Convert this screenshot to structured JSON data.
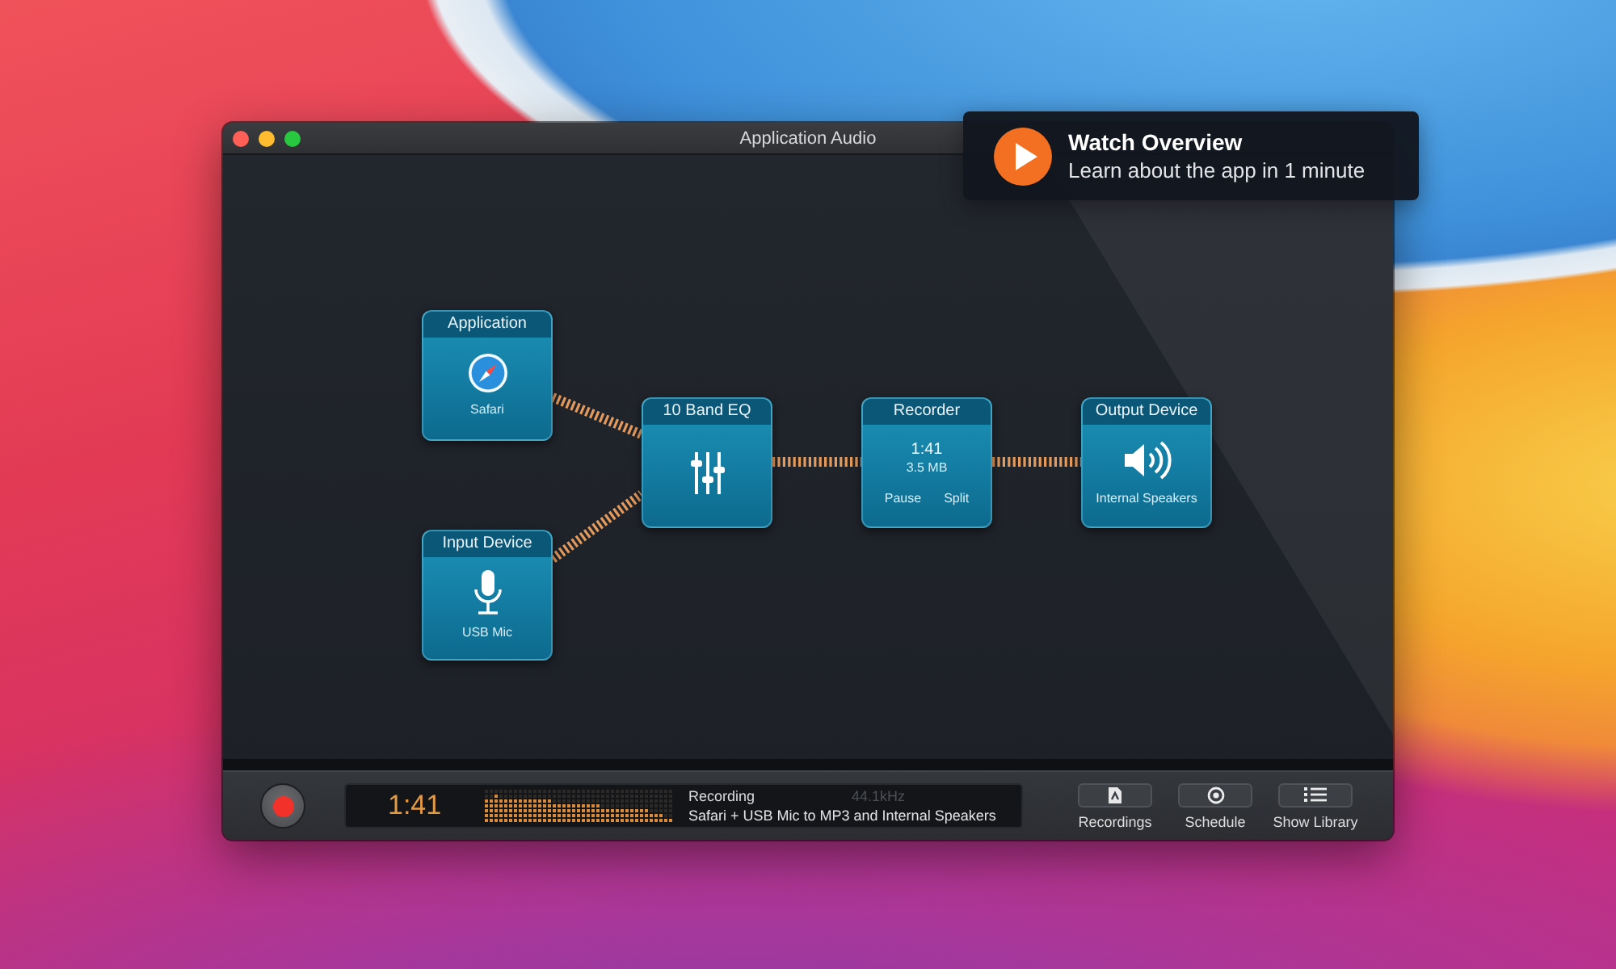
{
  "window": {
    "title": "Application Audio"
  },
  "overview": {
    "title": "Watch Overview",
    "subtitle": "Learn about the app in 1 minute"
  },
  "nodes": [
    {
      "kind": "application",
      "title": "Application",
      "label": "Safari"
    },
    {
      "kind": "input",
      "title": "Input Device",
      "label": "USB Mic"
    },
    {
      "kind": "effect",
      "title": "10 Band EQ"
    },
    {
      "kind": "recorder",
      "title": "Recorder",
      "time": "1:41",
      "size": "3.5 MB",
      "buttons": [
        "Pause",
        "Split"
      ]
    },
    {
      "kind": "output",
      "title": "Output Device",
      "label": "Internal Speakers"
    }
  ],
  "status": {
    "time": "1:41",
    "state": "Recording",
    "sample_rate": "44.1kHz",
    "description": "Safari + USB Mic to MP3 and Internal Speakers"
  },
  "toolbar": [
    {
      "kind": "recordings",
      "label": "Recordings"
    },
    {
      "kind": "schedule",
      "label": "Schedule"
    },
    {
      "kind": "library",
      "label": "Show Library"
    }
  ]
}
